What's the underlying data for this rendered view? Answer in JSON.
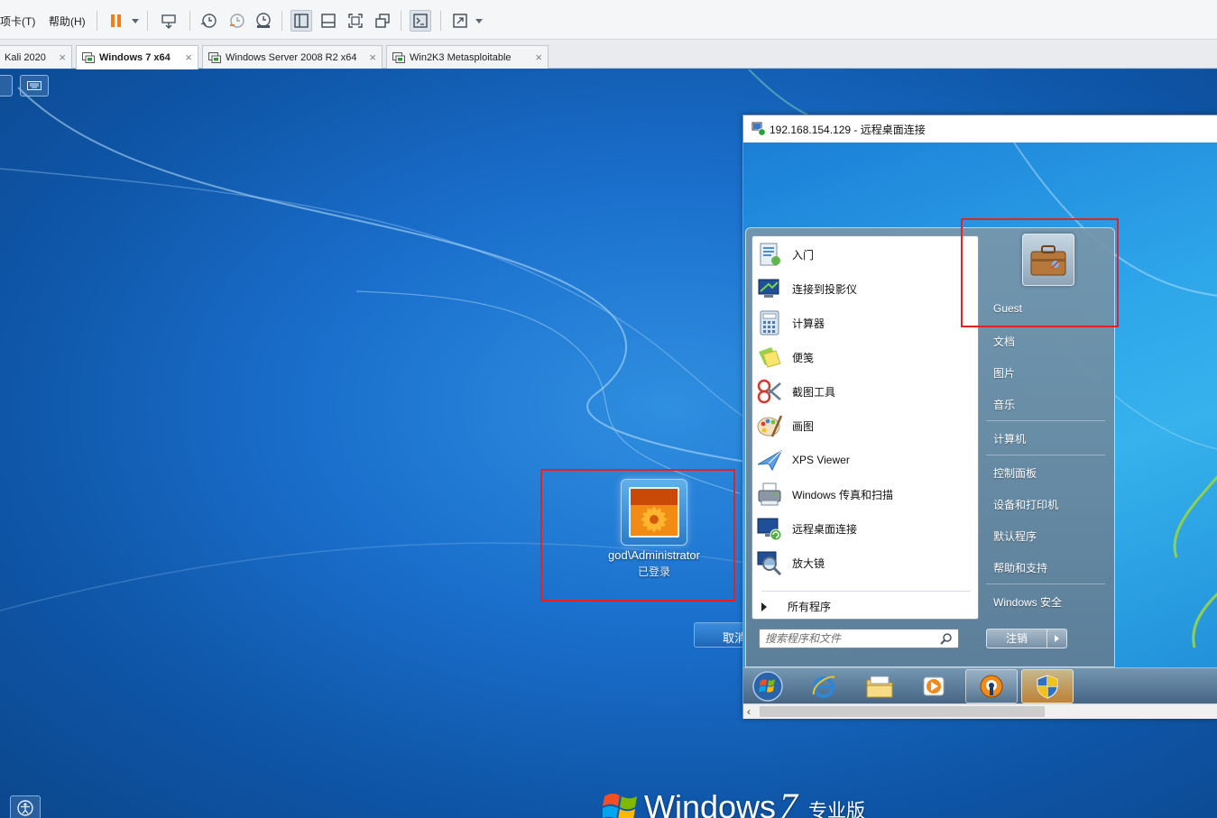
{
  "menubar": {
    "tabs_menu": "项卡(T)",
    "help_menu": "帮助(H)"
  },
  "vm_tabs": [
    {
      "label": "Kali 2020"
    },
    {
      "label": "Windows 7 x64"
    },
    {
      "label": "Windows Server 2008 R2 x64"
    },
    {
      "label": "Win2K3 Metasploitable"
    }
  ],
  "tab_close_glyph": "×",
  "guest": {
    "user_name": "god\\Administrator",
    "user_status": "已登录",
    "cancel_label": "取消",
    "os_brand": "Windows",
    "os_version": "7",
    "os_edition": "专业版"
  },
  "rdp": {
    "title": "192.168.154.129 - 远程桌面连接",
    "start_menu": {
      "programs": [
        {
          "label": "入门",
          "icon": "getting-started-icon"
        },
        {
          "label": "连接到投影仪",
          "icon": "projector-icon"
        },
        {
          "label": "计算器",
          "icon": "calculator-icon"
        },
        {
          "label": "便笺",
          "icon": "sticky-notes-icon"
        },
        {
          "label": "截图工具",
          "icon": "snipping-tool-icon"
        },
        {
          "label": "画图",
          "icon": "paint-icon"
        },
        {
          "label": "XPS Viewer",
          "icon": "xps-viewer-icon"
        },
        {
          "label": "Windows 传真和扫描",
          "icon": "fax-scan-icon"
        },
        {
          "label": "远程桌面连接",
          "icon": "remote-desktop-icon"
        },
        {
          "label": "放大镜",
          "icon": "magnifier-icon"
        }
      ],
      "all_programs": "所有程序",
      "search_placeholder": "搜索程序和文件",
      "user": "Guest",
      "right_items": [
        "文档",
        "图片",
        "音乐",
        "计算机",
        "控制面板",
        "设备和打印机",
        "默认程序",
        "帮助和支持",
        "Windows 安全"
      ],
      "logoff_label": "注销"
    },
    "taskbar": [
      "start-orb-icon",
      "internet-explorer-icon",
      "explorer-icon",
      "media-player-icon",
      "openvpn-icon",
      "windows-security-icon"
    ]
  },
  "colors": {
    "highlight_box": "#e52222",
    "pause_icon": "#f07f1a",
    "desktop_blue": "#1566c2"
  }
}
